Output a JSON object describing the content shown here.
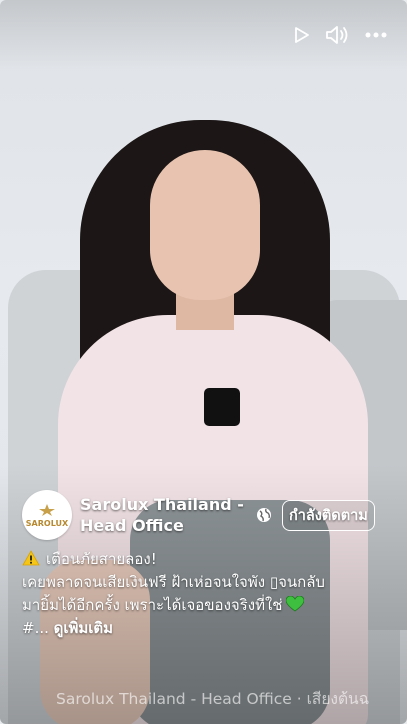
{
  "video": {
    "page_name": "Sarolux Thailand - Head Office",
    "follow_label": "กำลังติดตาม",
    "avatar_text": "SAROLUX",
    "caption_line1": "เตือนภัยสายลอง!",
    "caption_line2": "เคยพลาดจนเสียเงินฟรี ฝ้าเห่อจนใจพัง ▯จนกลับ",
    "caption_line3": "มายิ้มได้อีกครั้ง เพราะได้เจอของจริงที่ใช่",
    "hashtag_prefix": "#...",
    "see_more": "ดูเพิ่มเติม",
    "audio_line": "Sarolux Thailand - Head Office · เสียงต้นฉ"
  },
  "icons": {
    "play": "play-icon",
    "volume": "volume-icon",
    "more": "more-icon",
    "globe": "globe-icon",
    "warning": "warning-icon",
    "heart": "green-heart-icon"
  },
  "colors": {
    "heart": "#3fbf3f",
    "warning": "#f5c518",
    "text": "#ffffff"
  }
}
